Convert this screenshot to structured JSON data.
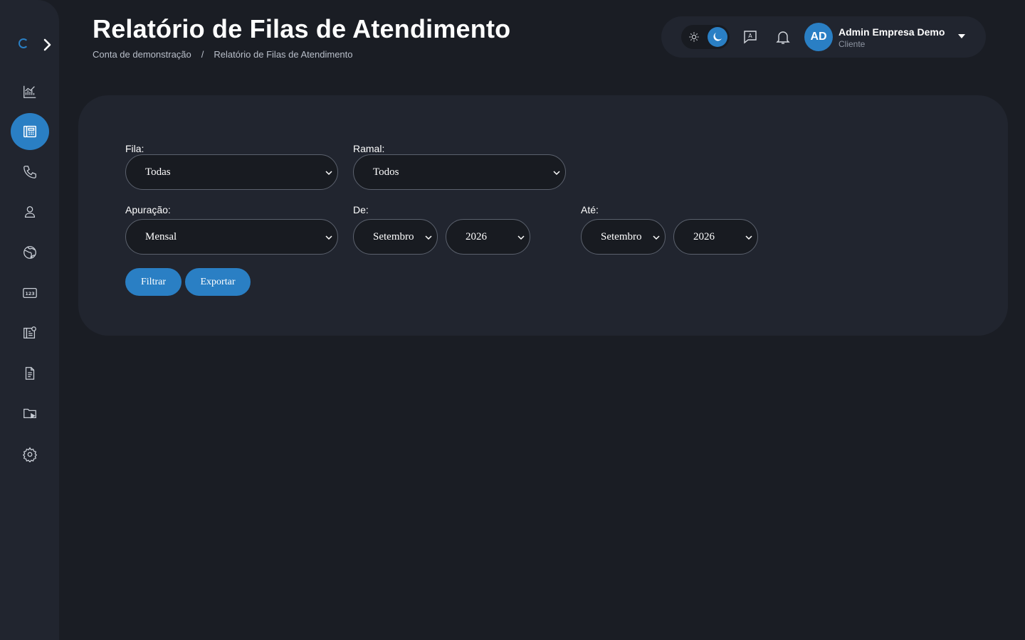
{
  "header": {
    "title": "Relatório de Filas de Atendimento",
    "breadcrumb": [
      "Conta de demonstração",
      "/",
      "Relatório de Filas de Atendimento"
    ]
  },
  "user": {
    "initials": "AD",
    "name": "Admin Empresa Demo",
    "role": "Cliente"
  },
  "sidebar": {
    "items": [
      {
        "icon": "chart-icon"
      },
      {
        "icon": "phonebook-icon",
        "active": true
      },
      {
        "icon": "phone-icon"
      },
      {
        "icon": "user-icon"
      },
      {
        "icon": "globe-icon"
      },
      {
        "icon": "numbers-icon"
      },
      {
        "icon": "settings-book-icon"
      },
      {
        "icon": "document-icon"
      },
      {
        "icon": "folder-play-icon"
      },
      {
        "icon": "gear-icon"
      }
    ]
  },
  "filters": {
    "fila": {
      "label": "Fila:",
      "value": "Todas"
    },
    "ramal": {
      "label": "Ramal:",
      "value": "Todos"
    },
    "apuracao": {
      "label": "Apuração:",
      "value": "Mensal"
    },
    "de": {
      "label": "De:",
      "month": "Setembro",
      "year": "2026"
    },
    "ate": {
      "label": "Até:",
      "month": "Setembro",
      "year": "2026"
    }
  },
  "actions": {
    "filter": "Filtrar",
    "export": "Exportar"
  },
  "colors": {
    "accent": "#2a7fc4",
    "background": "#1a1d24",
    "panel": "#21252f"
  }
}
